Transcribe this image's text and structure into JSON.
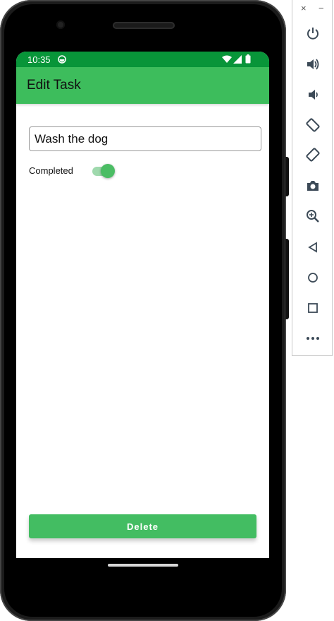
{
  "status_bar": {
    "time": "10:35"
  },
  "app_bar": {
    "title": "Edit Task"
  },
  "form": {
    "task_value": "Wash the dog",
    "completed_label": "Completed",
    "completed": true
  },
  "delete_label": "Delete",
  "colors": {
    "status_bar": "#089539",
    "app_bar": "#3dbd5c",
    "button": "#43bd62",
    "switch_thumb": "#4bbd64",
    "switch_track": "#9fd9ad"
  },
  "emulator_panel": {
    "close_glyph": "×",
    "minimize_glyph": "−",
    "tools": [
      "power-icon",
      "volume-up-icon",
      "volume-down-icon",
      "rotate-left-icon",
      "rotate-right-icon",
      "camera-icon",
      "zoom-icon",
      "back-icon",
      "home-icon",
      "overview-icon",
      "more-icon"
    ]
  }
}
